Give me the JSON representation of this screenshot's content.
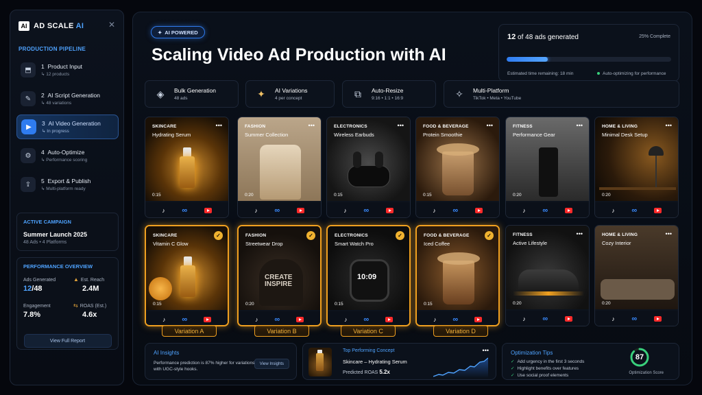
{
  "brand": {
    "mark": "AI",
    "name": "AD SCALE",
    "name_accent": "AI"
  },
  "sidebar": {
    "pipeline_title": "PRODUCTION PIPELINE",
    "steps": [
      {
        "num": "1",
        "title": "Product Input",
        "sub": "12 products",
        "icon": "inbox-icon"
      },
      {
        "num": "2",
        "title": "AI Script Generation",
        "sub": "48 variations",
        "icon": "script-icon"
      },
      {
        "num": "3",
        "title": "AI Video Generation",
        "sub": "In progress",
        "icon": "video-icon",
        "active": true
      },
      {
        "num": "4",
        "title": "Auto-Optimize",
        "sub": "Performance scoring",
        "icon": "optimize-icon"
      },
      {
        "num": "5",
        "title": "Export & Publish",
        "sub": "Multi-platform ready",
        "icon": "export-icon"
      }
    ],
    "campaign": {
      "label": "ACTIVE CAMPAIGN",
      "name": "Summer Launch 2025",
      "sub": "48 Ads • 4 Platforms"
    },
    "performance": {
      "label": "PERFORMANCE OVERVIEW",
      "ads_generated_label": "Ads Generated",
      "ads_generated_done": "12",
      "ads_generated_total": "48",
      "reach_label": "Est. Reach",
      "reach_value": "2.4M",
      "engagement_label": "Engagement",
      "engagement_value": "7.8%",
      "roas_label": "ROAS (Est.)",
      "roas_value": "4.6x",
      "report_button": "View Full Report"
    }
  },
  "header": {
    "badge": "AI POWERED",
    "title": "Scaling Video Ad Production with AI"
  },
  "progress": {
    "count_done": "12",
    "count_text": "of 48 ads generated",
    "percent_text": "25% Complete",
    "fraction": 0.25,
    "eta": "Estimated time remaining: 18 min",
    "auto": "Auto-optimizing for performance"
  },
  "features": [
    {
      "title": "Bulk Generation",
      "sub": "48 ads"
    },
    {
      "title": "AI Variations",
      "sub": "4 per concept"
    },
    {
      "title": "Auto-Resize",
      "sub": "9:16 • 1:1 • 16:9"
    },
    {
      "title": "Multi-Platform",
      "sub": "TikTok • Meta • YouTube"
    }
  ],
  "cards_row1": [
    {
      "category": "SKINCARE",
      "name": "Hydrating Serum",
      "duration": "0:15"
    },
    {
      "category": "FASHION",
      "name": "Summer Collection",
      "duration": "0:20"
    },
    {
      "category": "ELECTRONICS",
      "name": "Wireless Earbuds",
      "duration": "0:15"
    },
    {
      "category": "FOOD & BEVERAGE",
      "name": "Protein Smoothie",
      "duration": "0:15"
    },
    {
      "category": "FITNESS",
      "name": "Performance Gear",
      "duration": "0:20"
    },
    {
      "category": "HOME & LIVING",
      "name": "Minimal Desk Setup",
      "duration": "0:20"
    }
  ],
  "cards_row2": [
    {
      "category": "SKINCARE",
      "name": "Vitamin C Glow",
      "duration": "0:15",
      "selected": true
    },
    {
      "category": "FASHION",
      "name": "Streetwear Drop",
      "duration": "0:20",
      "selected": true
    },
    {
      "category": "ELECTRONICS",
      "name": "Smart Watch Pro",
      "duration": "0:15",
      "selected": true
    },
    {
      "category": "FOOD & BEVERAGE",
      "name": "Iced Coffee",
      "duration": "0:15",
      "selected": true
    },
    {
      "category": "FITNESS",
      "name": "Active Lifestyle",
      "duration": "0:20"
    },
    {
      "category": "HOME & LIVING",
      "name": "Cozy Interior",
      "duration": "0:20"
    }
  ],
  "variations": [
    "Variation A",
    "Variation B",
    "Variation C",
    "Variation D"
  ],
  "platform_icons": {
    "tiktok": "♪",
    "meta": "∞"
  },
  "insights": {
    "title": "AI Insights",
    "text": "Performance prediction is 87% higher for variations with UGC-style hooks.",
    "button": "View Insights"
  },
  "top_concept": {
    "title": "Top Performing Concept",
    "name": "Skincare – Hydrating Serum",
    "roas_label": "Predicted ROAS",
    "roas_value": "5.2x"
  },
  "tips": {
    "title": "Optimization Tips",
    "items": [
      "Add urgency in the first 3 seconds",
      "Highlight benefits over features",
      "Use social proof elements"
    ],
    "score": "87",
    "score_fraction": 0.87,
    "score_label": "Optimization Score"
  },
  "colors": {
    "accent": "#2f7cf0",
    "selected": "#f0a020",
    "success": "#39d07c"
  }
}
